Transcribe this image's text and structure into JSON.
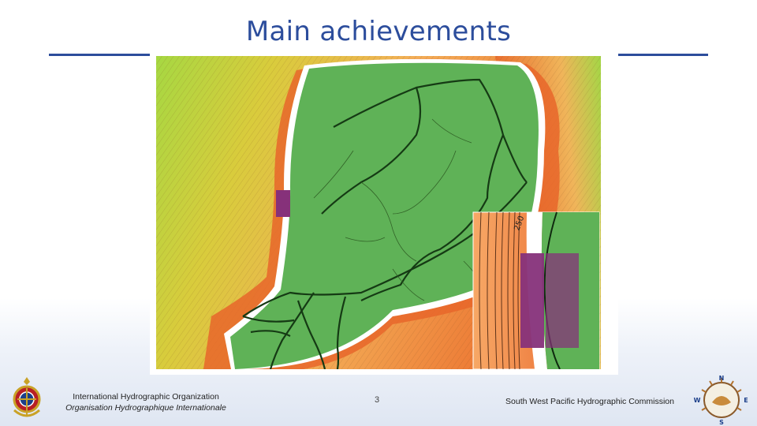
{
  "slide": {
    "title": "Main achievements",
    "page_number": "3"
  },
  "map": {
    "inset_contour_label": "250"
  },
  "footer": {
    "org_name_en": "International Hydrographic Organization",
    "org_name_fr": "Organisation Hydrographique Internationale",
    "commission": "South West Pacific Hydrographic Commission"
  },
  "logo_right": {
    "compass_n": "N",
    "compass_e": "E",
    "compass_s": "S",
    "compass_w": "W"
  },
  "colors": {
    "title": "#2c4d9c",
    "land": "#5fb257",
    "deep_orange": "#e8662a",
    "shallow_orange": "#f6a560",
    "highlight": "#86317a"
  }
}
